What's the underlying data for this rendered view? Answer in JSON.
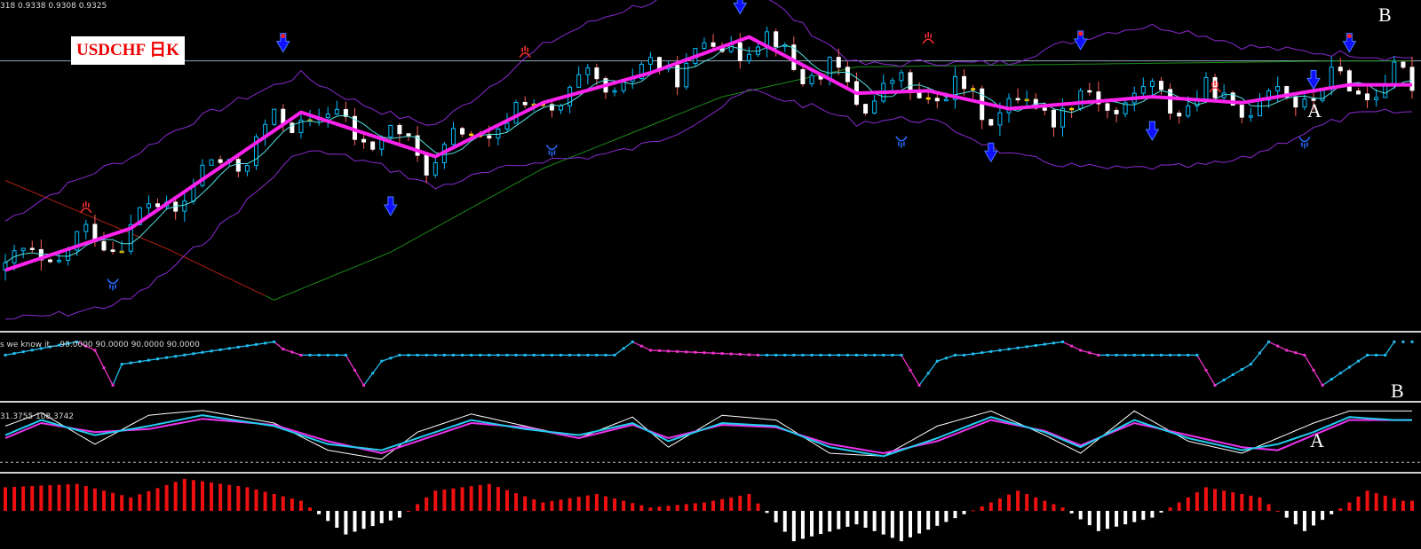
{
  "window": {
    "ohlc_text": "318 0.9338 0.9308 0.9325",
    "symbol_label": "USDCHF 日K"
  },
  "panels": {
    "main": {
      "markers": [
        "B",
        "A"
      ],
      "hline_color": "#8fa8b8",
      "up_candle_color": "#00bfff",
      "down_candle_color": "#ffffff",
      "doji_color": "#ffd700",
      "arrow_up_color": "#1010ff",
      "arrow_down_color": "#ff2020"
    },
    "stepline": {
      "info_text": "s we know it...  90.0000 90.0000 90.0000 90.0000",
      "marker": "B",
      "up_color": "#22bbee",
      "down_color": "#ee33cc"
    },
    "oscillator": {
      "info_text": "31.3755 108.3742",
      "marker": "A",
      "fast_color": "#22ccee",
      "slow_color": "#ee33ee",
      "raw_color": "#ffffff"
    },
    "histogram": {
      "pos_color": "#ee1010",
      "neg_color": "#ffffff"
    }
  },
  "chart_data": [
    {
      "type": "line",
      "name": "price",
      "title": "USDCHF 日K",
      "ylim": [
        0.912,
        0.937
      ],
      "hline": 0.9325,
      "trend": {
        "x": [
          0,
          14,
          33,
          48,
          60,
          72,
          83,
          95,
          103,
          112,
          128,
          138,
          150
        ],
        "y": [
          0.915,
          0.9185,
          0.9282,
          0.9245,
          0.929,
          0.9315,
          0.9345,
          0.9298,
          0.93,
          0.9285,
          0.9295,
          0.929,
          0.9305
        ]
      },
      "extremes": {
        "x": [
          0,
          14,
          31,
          43,
          60,
          82,
          105,
          110,
          120,
          130,
          140,
          150
        ],
        "y": [
          0.9148,
          0.9208,
          0.9328,
          0.9215,
          0.933,
          0.936,
          0.9325,
          0.926,
          0.933,
          0.9265,
          0.931,
          0.9328
        ]
      },
      "long_ma": {
        "x": [
          0,
          18,
          30,
          43,
          60,
          80,
          95,
          150
        ],
        "y": [
          0.9225,
          0.9168,
          0.9125,
          0.9165,
          0.9235,
          0.9295,
          0.932,
          0.9325
        ]
      },
      "arrows_up_x": [
        43,
        110,
        128,
        146
      ],
      "arrows_down_x": [
        31,
        82,
        120,
        150
      ],
      "signal_hands_top_x": [
        9,
        58,
        103,
        135
      ],
      "signal_hands_bottom_x": [
        12,
        61,
        100,
        145
      ]
    },
    {
      "type": "line",
      "name": "stepline",
      "ylim": [
        0,
        100
      ],
      "levels": [
        0,
        70,
        92
      ],
      "x": [
        0,
        8,
        10,
        12,
        13,
        30,
        31,
        33,
        38,
        40,
        42,
        44,
        45,
        68,
        70,
        72,
        84,
        86,
        100,
        102,
        104,
        106,
        107,
        118,
        120,
        122,
        133,
        135,
        139,
        141,
        143,
        145,
        147,
        152,
        154,
        155
      ],
      "y": [
        70,
        92,
        78,
        20,
        55,
        92,
        80,
        70,
        70,
        20,
        60,
        70,
        70,
        70,
        92,
        78,
        70,
        70,
        70,
        20,
        60,
        70,
        70,
        92,
        78,
        70,
        70,
        20,
        55,
        92,
        78,
        70,
        20,
        70,
        70,
        92
      ]
    },
    {
      "type": "line",
      "name": "oscillator",
      "ylim": [
        0,
        100
      ],
      "series": [
        {
          "values_x": [
            0,
            4,
            10,
            16,
            22,
            30,
            36,
            42,
            46,
            52,
            58,
            64,
            70,
            74,
            80,
            86,
            92,
            98,
            104,
            110,
            116,
            120,
            126,
            132,
            138,
            142,
            146,
            150,
            155
          ],
          "values": [
            55,
            80,
            55,
            70,
            88,
            70,
            40,
            30,
            50,
            80,
            65,
            55,
            75,
            45,
            75,
            70,
            35,
            20,
            50,
            85,
            60,
            35,
            80,
            50,
            30,
            40,
            60,
            85,
            80
          ]
        },
        {
          "values_x": [
            0,
            4,
            10,
            16,
            22,
            30,
            36,
            42,
            46,
            52,
            58,
            64,
            70,
            74,
            80,
            86,
            92,
            98,
            104,
            110,
            116,
            120,
            126,
            132,
            138,
            142,
            146,
            150,
            155
          ],
          "values": [
            50,
            75,
            60,
            65,
            82,
            72,
            45,
            25,
            45,
            75,
            68,
            50,
            72,
            50,
            72,
            68,
            40,
            25,
            45,
            80,
            62,
            38,
            75,
            55,
            35,
            30,
            55,
            80,
            80
          ]
        },
        {
          "values_x": [
            0,
            4,
            10,
            16,
            22,
            30,
            36,
            42,
            46,
            52,
            58,
            64,
            70,
            74,
            80,
            86,
            92,
            98,
            104,
            110,
            116,
            120,
            126,
            132,
            138,
            142,
            146,
            150,
            155
          ],
          "values": [
            70,
            92,
            40,
            88,
            96,
            75,
            30,
            15,
            60,
            90,
            70,
            50,
            85,
            35,
            88,
            80,
            25,
            20,
            70,
            95,
            55,
            25,
            95,
            45,
            25,
            50,
            75,
            95,
            95
          ]
        }
      ],
      "reference_level": 10
    },
    {
      "type": "bar",
      "name": "histogram",
      "zero_line": 0,
      "x": [
        0,
        8,
        14,
        20,
        27,
        33,
        38,
        44,
        48,
        54,
        60,
        66,
        72,
        78,
        83,
        88,
        95,
        100,
        107,
        113,
        118,
        122,
        128,
        134,
        140,
        145,
        148,
        152,
        156
      ],
      "values": [
        0.7,
        0.8,
        0.4,
        0.95,
        0.7,
        0.3,
        -0.7,
        -0.2,
        0.6,
        0.8,
        0.25,
        0.5,
        0.1,
        0.25,
        0.5,
        -0.9,
        -0.4,
        -0.9,
        -0.1,
        0.6,
        0.1,
        -0.6,
        -0.2,
        0.7,
        0.4,
        -0.6,
        -0.1,
        0.6,
        0.3
      ]
    }
  ]
}
